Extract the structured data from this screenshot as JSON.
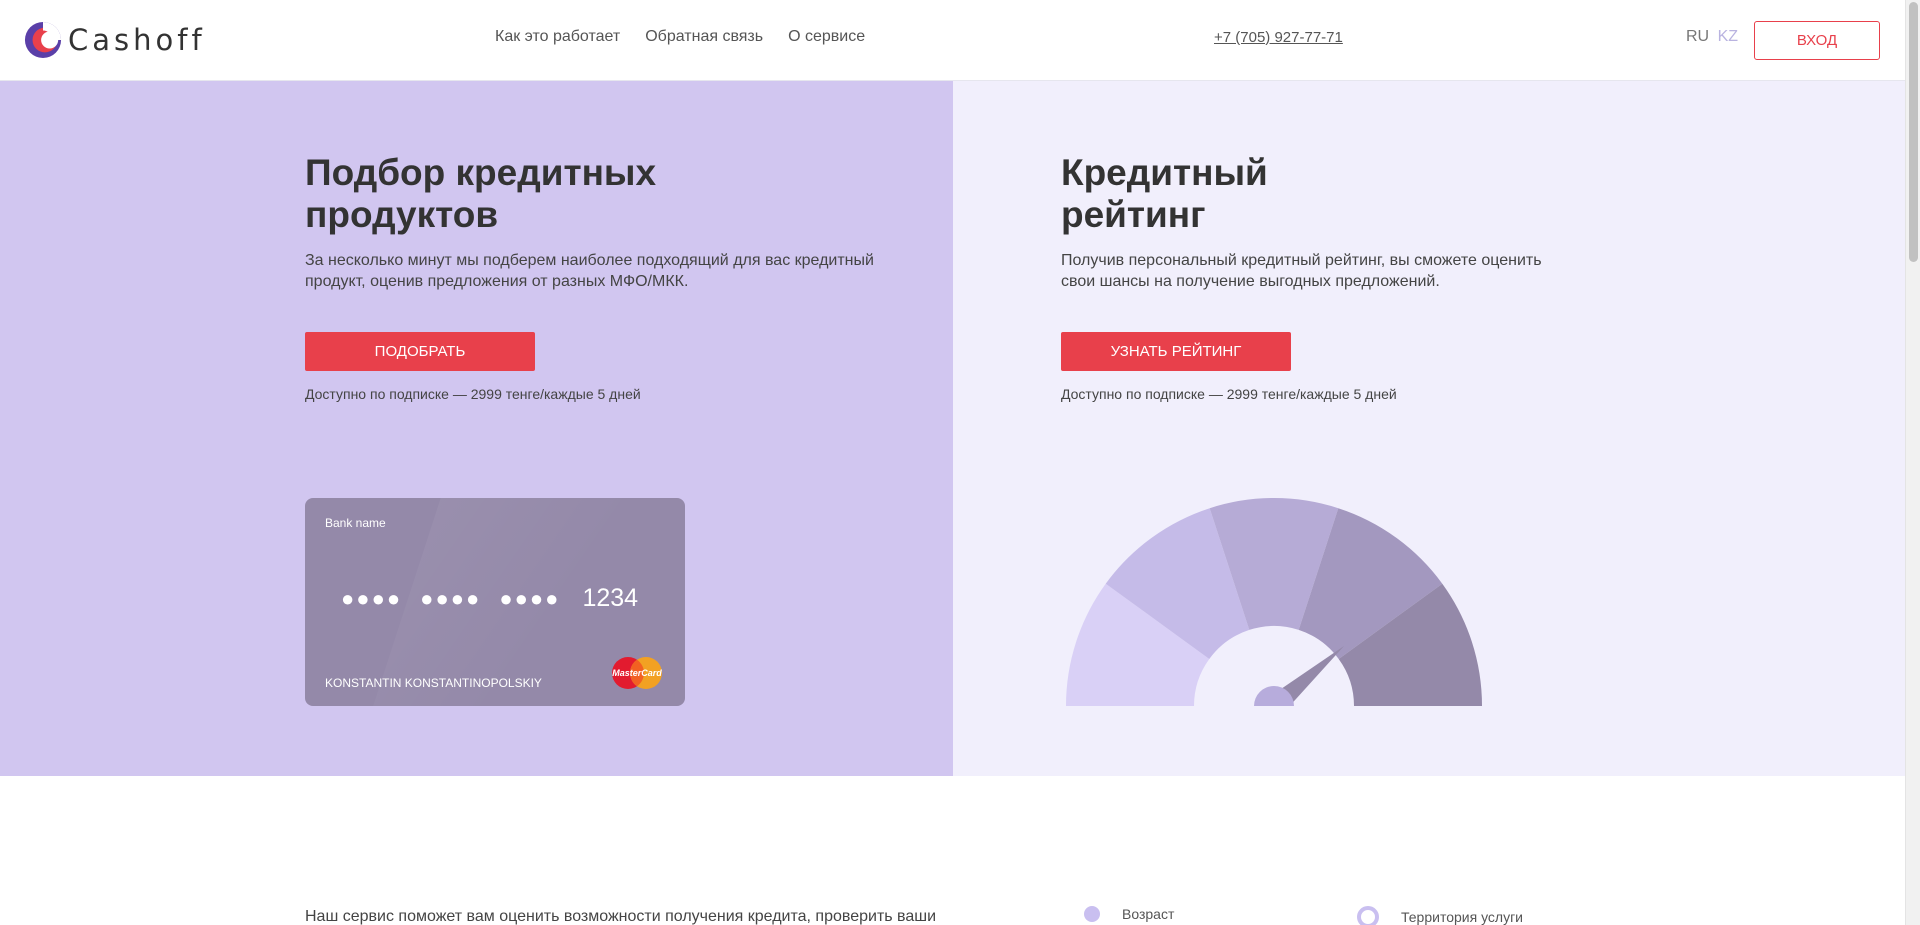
{
  "header": {
    "logo_text": "Cashoff",
    "nav": [
      "Как это работает",
      "Обратная связь",
      "О сервисе"
    ],
    "phone": "+7 (705) 927-77-71",
    "lang_ru": "RU",
    "lang_kz": "KZ",
    "login_label": "ВХОД"
  },
  "left": {
    "title_line1": "Подбор кредитных",
    "title_line2": "продуктов",
    "desc_line1": "За несколько минут мы подберем наиболее подходящий для вас кредитный",
    "desc_line2": "продукт, оценив предложения от разных МФО/МКК.",
    "button": "ПОДОБРАТЬ",
    "note": "Доступно по подписке — 2999 тенге/каждые 5 дней",
    "card": {
      "bank_name": "Bank name",
      "masked": "●●●●",
      "last4": "1234",
      "holder": "KONSTANTIN KONSTANTINOPOLSKIY",
      "brand": "MasterCard"
    }
  },
  "right": {
    "title_line1": "Кредитный",
    "title_line2": "рейтинг",
    "desc_line1": "Получив персональный кредитный рейтинг, вы сможете оценить",
    "desc_line2": "свои шансы на получение выгодных предложений.",
    "button": "УЗНАТЬ РЕЙТИНГ",
    "note": "Доступно по подписке — 2999 тенге/каждые 5 дней"
  },
  "lower": {
    "text": "Наш сервис поможет вам оценить возможности получения кредита, проверить ваши",
    "feature1": "Возраст",
    "feature2": "Территория услуги"
  },
  "colors": {
    "accent": "#e8404b",
    "left_bg": "#d1c6f0",
    "right_bg": "#f1effc",
    "card_bg": "#9489a9"
  }
}
